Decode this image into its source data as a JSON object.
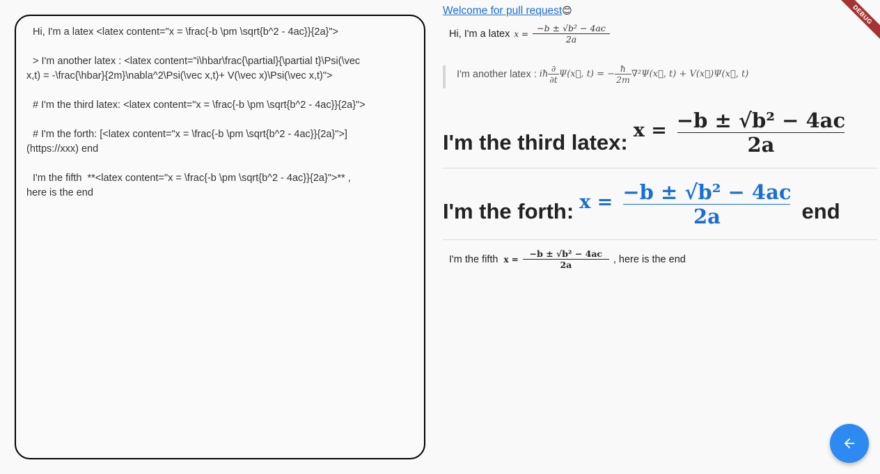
{
  "editor": {
    "lines": [
      "Hi, I'm a latex <latex content=\"x = \\frac{-b \\pm \\sqrt{b^2 - 4ac}}{2a}\">",
      "> I'm another latex : <latex content=\"i\\hbar\\frac{\\partial}{\\partial t}\\Psi(\\vec",
      "x,t) = -\\frac{\\hbar}{2m}\\nabla^2\\Psi(\\vec x,t)+ V(\\vec x)\\Psi(\\vec x,t)\">",
      "# I'm the third latex: <latex content=\"x = \\frac{-b \\pm \\sqrt{b^2 - 4ac}}{2a}\">",
      "# I'm the forth: [<latex content=\"x = \\frac{-b \\pm \\sqrt{b^2 - 4ac}}{2a}\">]",
      "(https://xxx) end",
      "I'm the fifth  **<latex content=\"x = \\frac{-b \\pm \\sqrt{b^2 - 4ac}}{2a}\">** ,",
      "here is the end"
    ]
  },
  "preview": {
    "link": "Welcome for pull request",
    "link_emoji": "😊",
    "line1_text": "Hi, I'm a latex",
    "line2_text": "I'm another latex :",
    "heading3": "I'm the third latex:",
    "heading4": "I'm the forth:",
    "heading4_end": "end",
    "line5_text": "I'm the fifth",
    "line5_end": ", here is the end",
    "quadratic": {
      "lhs": "x =",
      "num": "−b ± √b² − 4ac",
      "den": "2a"
    },
    "schrodinger": {
      "lhs_prefix": "iħ",
      "lhs_num": "∂",
      "lhs_den": "∂t",
      "lhs_rest": "Ψ(x⃗, t) = −",
      "rhs_num": "ħ",
      "rhs_den": "2m",
      "rhs_rest": "∇²Ψ(x⃗, t) + V(x⃗)Ψ(x⃗, t)"
    }
  },
  "debug_banner": "DEBUG",
  "fab": {
    "icon": "arrow-left-icon"
  },
  "colors": {
    "link": "#1a6fd6",
    "accent": "#2c8af2",
    "banner": "#a43434"
  }
}
